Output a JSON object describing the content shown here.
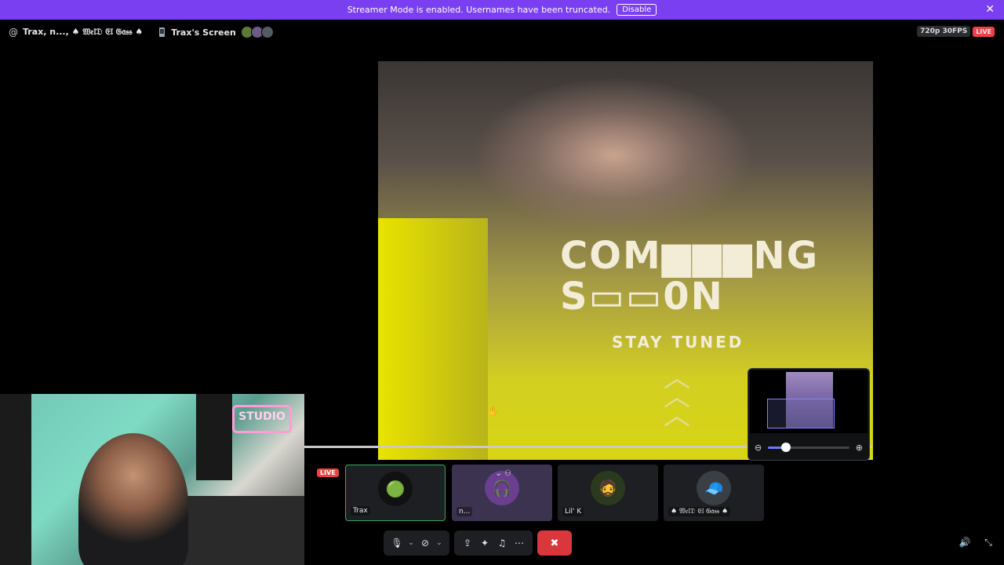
{
  "banner": {
    "text": "Streamer Mode is enabled. Usernames have been truncated.",
    "disable_label": "Disable",
    "close_glyph": "✕"
  },
  "header": {
    "at_icon": "@",
    "channel_name": "Trax, n..., ♠ 𝔚𝔢𝔩𝔇 𝔈𝔩 𝔊𝔞𝔰𝔰 ♠",
    "screen_title": "Trax's Screen",
    "quality": "720p 30FPS",
    "live": "LIVE"
  },
  "stream": {
    "line1": "COM▆▆▆NG",
    "line2": "S▭▭0N",
    "tagline": "STAY TUNED",
    "chevrons": "︿\n︿\n︿"
  },
  "zoom": {
    "out_icon": "⊖",
    "in_icon": "⊕",
    "level": 0.22
  },
  "strip": {
    "live_label": "LIVE",
    "tiles": [
      {
        "name": "Trax",
        "avatar": "🟢"
      },
      {
        "name": "n...",
        "avatar": "🎧"
      },
      {
        "name": "Lil' K",
        "avatar": "🧔"
      },
      {
        "name": "♠ 𝔚𝔢𝔩𝔇 𝔈𝔩 𝔊𝔞𝔰𝔰 ♠",
        "avatar": "🧢"
      }
    ]
  },
  "webcam": {
    "sign_text": "STUDIO"
  },
  "controls": {
    "mic": "🎙",
    "chevron": "⌄",
    "camera_off": "⊘",
    "screen_share": "⇪",
    "activities": "✦",
    "soundboard": "♫",
    "more": "⋯",
    "leave": "✖",
    "volume": "🔊",
    "collapse": "⤡"
  },
  "cursor": "✋"
}
